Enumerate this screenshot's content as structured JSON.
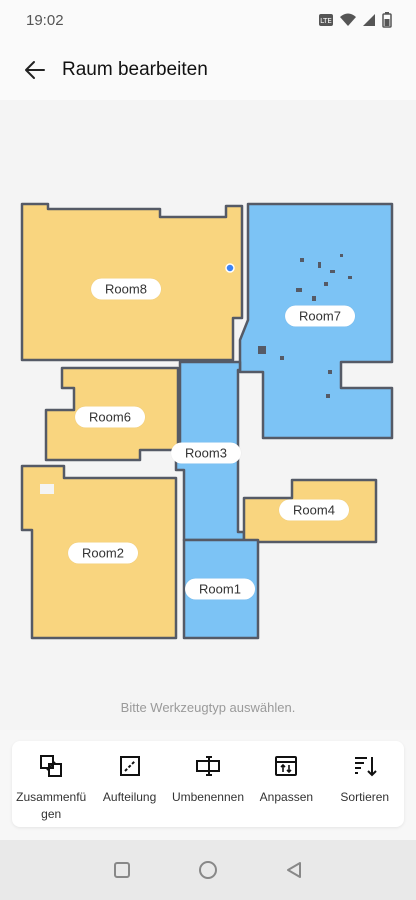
{
  "status": {
    "time": "19:02"
  },
  "header": {
    "title": "Raum bearbeiten"
  },
  "rooms": [
    {
      "id": "room8",
      "label": "Room8"
    },
    {
      "id": "room7",
      "label": "Room7"
    },
    {
      "id": "room6",
      "label": "Room6"
    },
    {
      "id": "room3",
      "label": "Room3"
    },
    {
      "id": "room4",
      "label": "Room4"
    },
    {
      "id": "room2",
      "label": "Room2"
    },
    {
      "id": "room1",
      "label": "Room1"
    }
  ],
  "colors": {
    "yellow": "#f9d57f",
    "blue": "#7cc3f5",
    "border": "#555a66",
    "accent": "#3b82f6"
  },
  "hint": "Bitte Werkzeugtyp auswählen.",
  "toolbar": {
    "merge": "Zusammenfü gen",
    "merge_line1": "Zusammenfü",
    "merge_line2": "gen",
    "split": "Aufteilung",
    "rename": "Umbenennen",
    "adjust": "Anpassen",
    "sort": "Sortieren"
  }
}
